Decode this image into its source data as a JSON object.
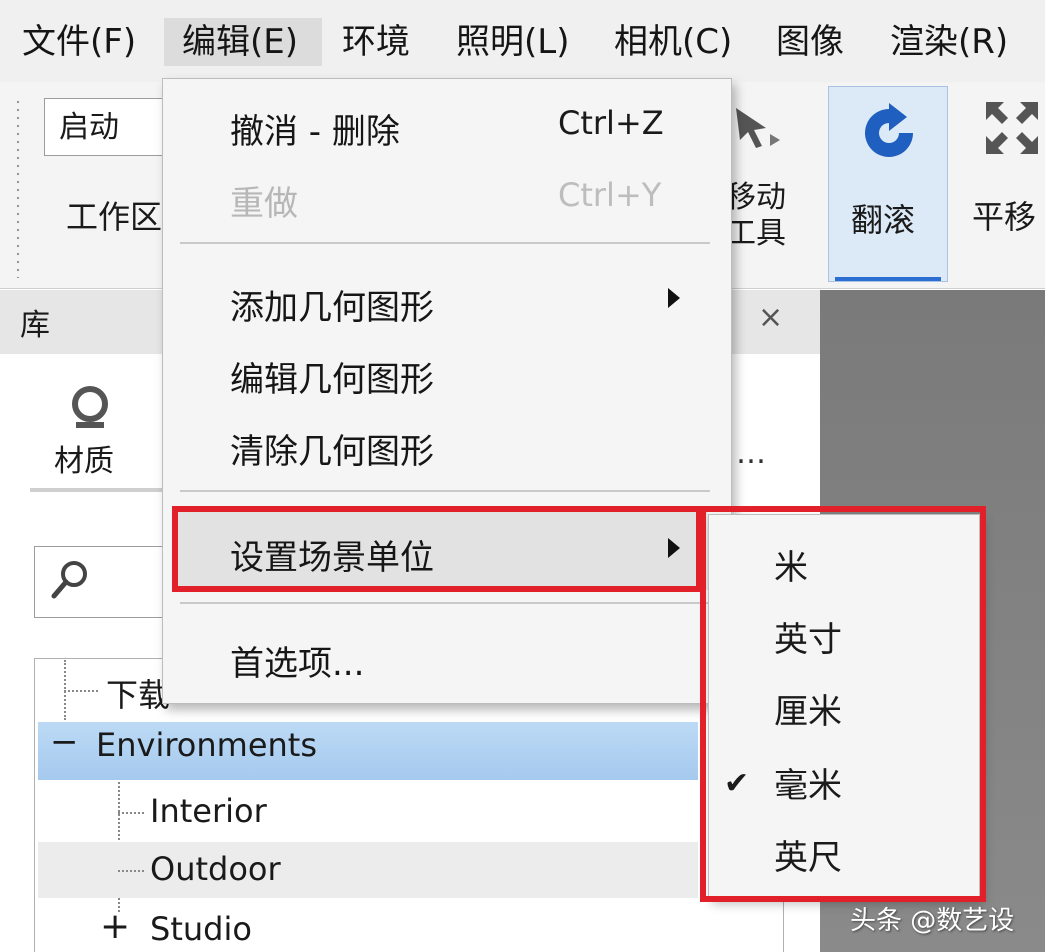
{
  "menubar": {
    "items": [
      {
        "label": "文件(F)"
      },
      {
        "label": "编辑(E)"
      },
      {
        "label": "环境"
      },
      {
        "label": "照明(L)"
      },
      {
        "label": "相机(C)"
      },
      {
        "label": "图像"
      },
      {
        "label": "渲染(R)"
      }
    ],
    "active_index": 1
  },
  "toolbar": {
    "start_select_value": "启动",
    "workspace_label": "工作区",
    "move_tool_label": "移动\n工具",
    "tumble_label": "翻滚",
    "pan_label": "平移"
  },
  "library": {
    "title": "库",
    "close_glyph": "×",
    "material_label": "材质",
    "ellipsis": "…",
    "tree": {
      "download": "下载",
      "environments": "Environments",
      "interior": "Interior",
      "outdoor": "Outdoor",
      "studio": "Studio",
      "minus": "−",
      "plus": "+"
    }
  },
  "edit_menu": {
    "undo": {
      "label": "撤消 - 删除",
      "shortcut": "Ctrl+Z"
    },
    "redo": {
      "label": "重做",
      "shortcut": "Ctrl+Y"
    },
    "add_geometry": "添加几何图形",
    "edit_geometry": "编辑几何图形",
    "clear_geometry": "清除几何图形",
    "set_scene_units": "设置场景单位",
    "preferences": "首选项..."
  },
  "units_submenu": {
    "items": [
      "米",
      "英寸",
      "厘米",
      "毫米",
      "英尺"
    ],
    "checked": "毫米",
    "check_glyph": "✔"
  },
  "colors": {
    "highlight_red": "#e2202a",
    "selection_blue": "#a5c9ee",
    "tumble_accent": "#2a6fd1"
  },
  "watermark": "头条 @数艺设"
}
